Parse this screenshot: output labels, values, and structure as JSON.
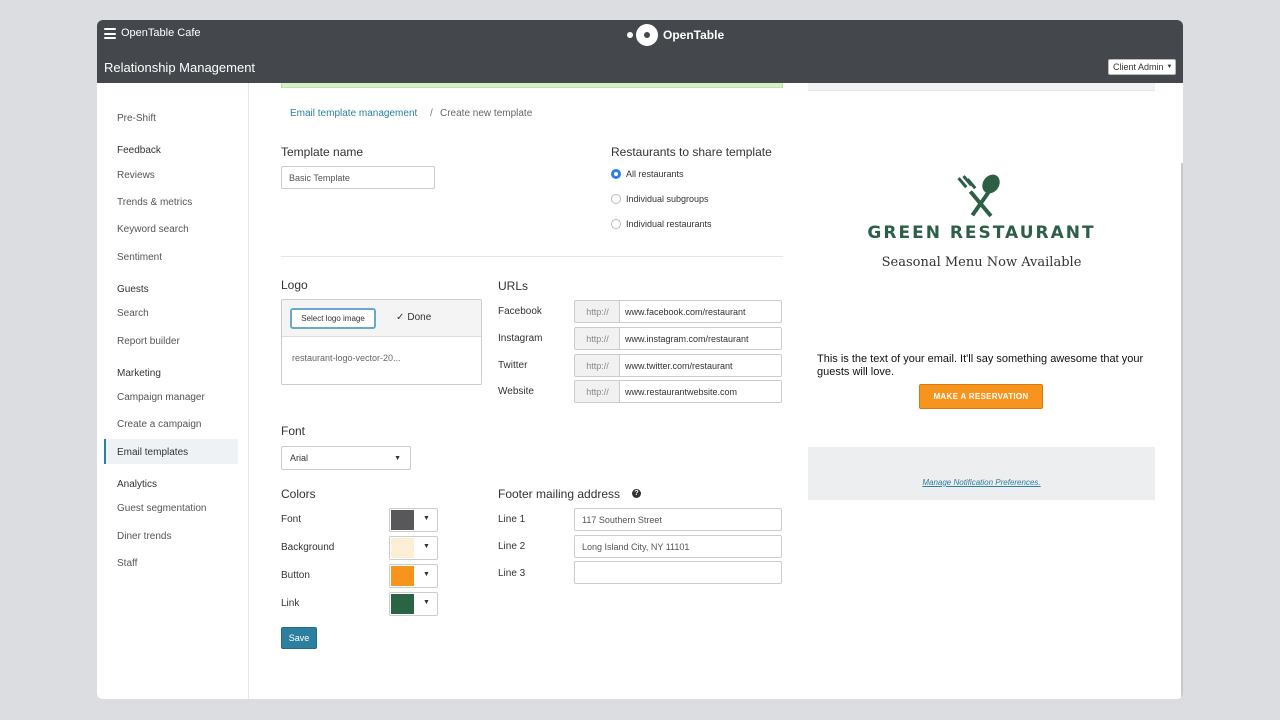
{
  "topbar": {
    "cafe_name": "OpenTable Cafe",
    "brand": "OpenTable",
    "page_title": "Relationship Management",
    "role": "Client Admin"
  },
  "sidebar": {
    "pre_shift": "Pre-Shift",
    "feedback_heading": "Feedback",
    "reviews": "Reviews",
    "trends": "Trends & metrics",
    "keyword": "Keyword search",
    "sentiment": "Sentiment",
    "guests_heading": "Guests",
    "search": "Search",
    "report_builder": "Report builder",
    "marketing_heading": "Marketing",
    "campaign_manager": "Campaign manager",
    "create_campaign": "Create a campaign",
    "email_templates": "Email templates",
    "analytics_heading": "Analytics",
    "guest_segmentation": "Guest segmentation",
    "diner_trends": "Diner trends",
    "staff": "Staff"
  },
  "breadcrumb": {
    "parent": "Email template management",
    "separator": "/",
    "current": "Create new template"
  },
  "form": {
    "template_name_label": "Template name",
    "template_name_value": "Basic Template",
    "share_label": "Restaurants to share template",
    "share_options": [
      "All restaurants",
      "Individual subgroups",
      "Individual restaurants"
    ],
    "share_selected": "All restaurants",
    "logo_label": "Logo",
    "select_logo": "Select logo image",
    "done": "Done",
    "logo_file": "restaurant-logo-vector-20...",
    "urls_label": "URLs",
    "url_prefix": "http://",
    "urls": [
      {
        "label": "Facebook",
        "value": "www.facebook.com/restaurant"
      },
      {
        "label": "Instagram",
        "value": "www.instagram.com/restaurant"
      },
      {
        "label": "Twitter",
        "value": "www.twitter.com/restaurant"
      },
      {
        "label": "Website",
        "value": "www.restaurantwebsite.com"
      }
    ],
    "font_label": "Font",
    "font_value": "Arial",
    "colors_label": "Colors",
    "colors": [
      {
        "label": "Font",
        "hex": "#58585a"
      },
      {
        "label": "Background",
        "hex": "#fdefd6"
      },
      {
        "label": "Button",
        "hex": "#f7941d"
      },
      {
        "label": "Link",
        "hex": "#2a6444"
      }
    ],
    "footer_label": "Footer mailing address",
    "footer_lines": [
      {
        "label": "Line 1",
        "value": "117 Southern Street"
      },
      {
        "label": "Line 2",
        "value": "Long Island City, NY 11101"
      },
      {
        "label": "Line 3",
        "value": ""
      }
    ],
    "save": "Save"
  },
  "preview": {
    "restaurant_name": "GREEN RESTAURANT",
    "subtitle": "Seasonal Menu Now Available",
    "body": "This is the text of your email. It'll say something awesome that your guests will love.",
    "reserve_button": "MAKE A RESERVATION",
    "manage_link": "Manage Notification Preferences."
  },
  "colors": {
    "topbar": "#44474c",
    "accent": "#2d7f9f",
    "restaurant_green": "#2c5f46"
  }
}
